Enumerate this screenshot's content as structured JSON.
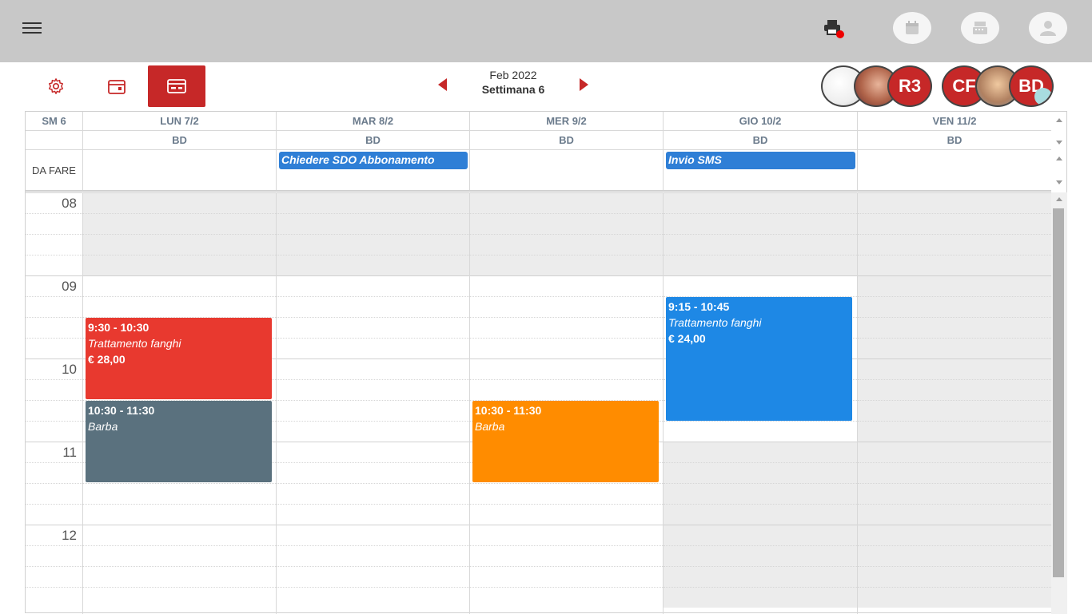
{
  "toolbar": {
    "month": "Feb 2022",
    "week": "Settimana 6"
  },
  "avatars": [
    {
      "label": ""
    },
    {
      "label": ""
    },
    {
      "label": "R3"
    },
    {
      "label": "CF"
    },
    {
      "label": ""
    },
    {
      "label": "BD"
    }
  ],
  "calendar": {
    "week_label": "SM 6",
    "todo_label": "DA FARE",
    "days": [
      {
        "name": "LUN 7/2",
        "staff": "BD"
      },
      {
        "name": "MAR 8/2",
        "staff": "BD"
      },
      {
        "name": "MER 9/2",
        "staff": "BD"
      },
      {
        "name": "GIO 10/2",
        "staff": "BD"
      },
      {
        "name": "VEN 11/2",
        "staff": "BD"
      }
    ],
    "todos": [
      {
        "text": "Chiedere SDO Abbonamento"
      },
      {
        "text": "Invio SMS"
      }
    ],
    "hours": [
      "08",
      "09",
      "10",
      "11",
      "12"
    ],
    "appointments": [
      {
        "time": "9:30 - 10:30",
        "service": "Trattamento fanghi",
        "price": "€ 28,00",
        "color": "#e8392f"
      },
      {
        "time": "10:30 - 11:30",
        "service": "Barba",
        "price": "",
        "color": "#5a717e"
      },
      {
        "time": "10:30 - 11:30",
        "service": "Barba",
        "price": "",
        "color": "#ff8c00"
      },
      {
        "time": "9:15 - 10:45",
        "service": "Trattamento fanghi",
        "price": "€ 24,00",
        "color": "#1e88e5"
      }
    ]
  },
  "colors": {
    "accent": "#c62828",
    "topbar": "#c8c8c8",
    "todo": "#2f7fd6",
    "closed": "#ececec"
  }
}
